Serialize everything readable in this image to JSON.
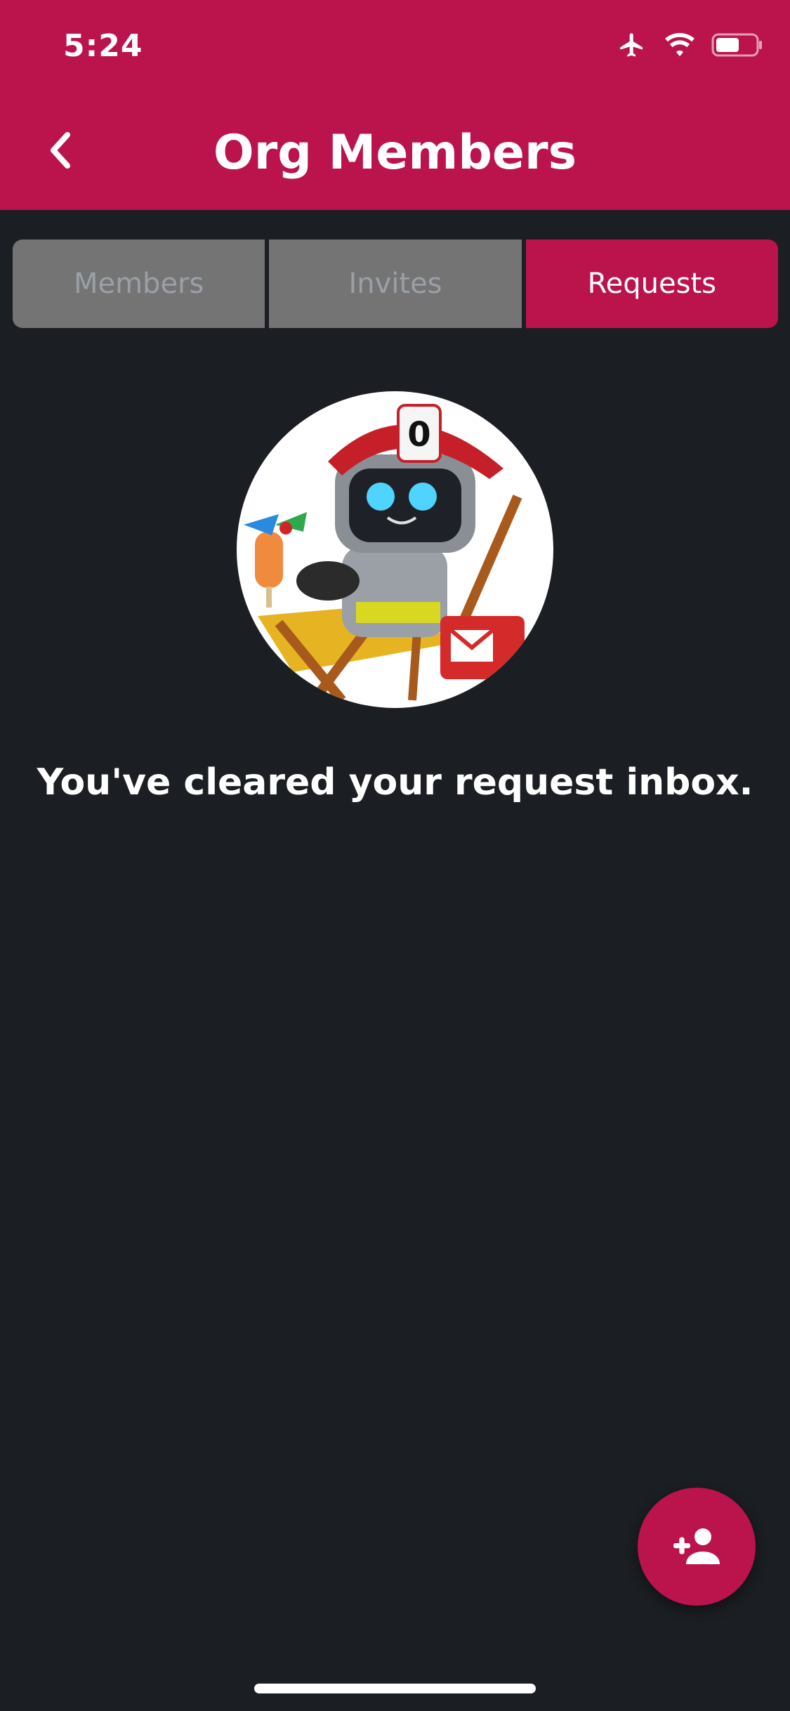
{
  "status_bar": {
    "time": "5:24",
    "icons": [
      "airplane-icon",
      "wifi-icon",
      "battery-icon"
    ]
  },
  "header": {
    "title": "Org Members",
    "back_icon": "chevron-left-icon"
  },
  "tabs": [
    {
      "label": "Members",
      "active": false
    },
    {
      "label": "Invites",
      "active": false
    },
    {
      "label": "Requests",
      "active": true
    }
  ],
  "empty_state": {
    "message": "You've cleared your request inbox."
  },
  "fab": {
    "icon": "add-person-icon"
  },
  "colors": {
    "brand": "#bb134c",
    "background": "#1b1e22",
    "inactive_tab": "#747474",
    "inactive_tab_text": "#9aa0a6"
  }
}
